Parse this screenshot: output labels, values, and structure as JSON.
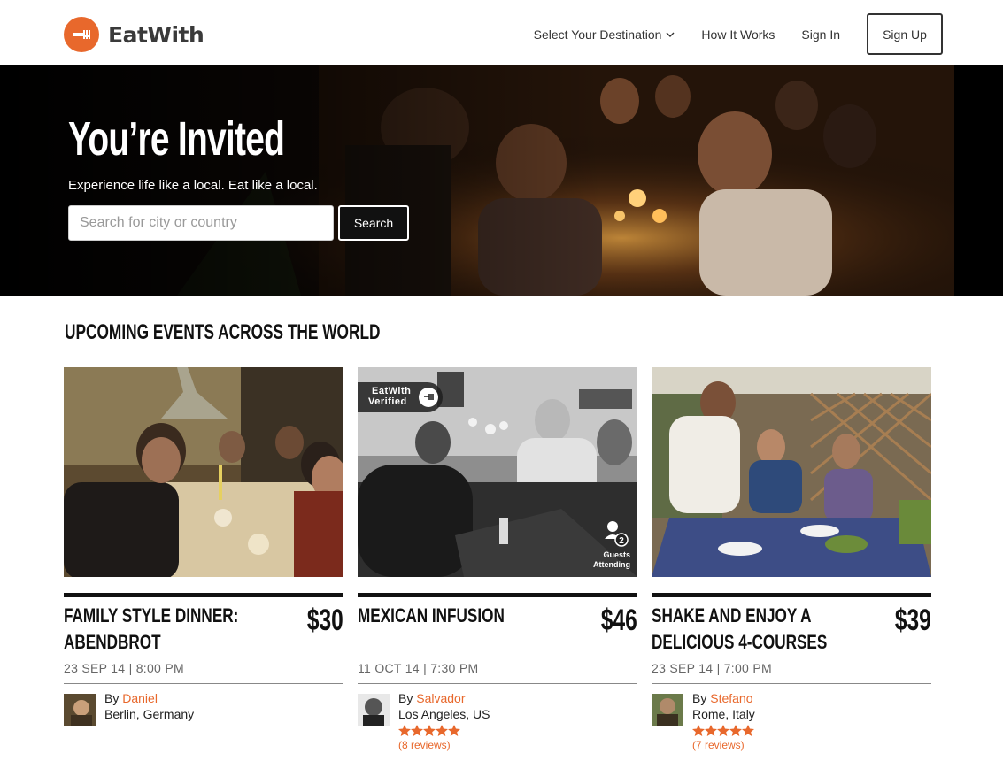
{
  "brand": {
    "name": "EatWith",
    "accent": "#e8682c"
  },
  "nav": {
    "destination": "Select Your Destination",
    "how_it_works": "How It Works",
    "sign_in": "Sign In",
    "sign_up": "Sign Up"
  },
  "hero": {
    "title": "You’re Invited",
    "subtitle": "Experience life like a local. Eat like a local.",
    "search_placeholder": "Search for city or country",
    "search_button": "Search"
  },
  "section": {
    "title": "UPCOMING EVENTS ACROSS THE WORLD"
  },
  "events": [
    {
      "title": "FAMILY STYLE DINNER: ABENDBROT",
      "price": "$30",
      "date": "23 SEP 14 | 8:00 PM",
      "by_prefix": "By",
      "host": "Daniel",
      "location": "Berlin, Germany"
    },
    {
      "title": "MEXICAN INFUSION",
      "price": "$46",
      "date": "11 OCT 14 | 7:30 PM",
      "by_prefix": "By",
      "host": "Salvador",
      "location": "Los Angeles, US",
      "rating_stars": 5,
      "reviews": "(8 reviews)",
      "badge_line1": "EatWith",
      "badge_line2": "Verified",
      "guests_count": "2",
      "guests_line1": "Guests",
      "guests_line2": "Attending"
    },
    {
      "title": "SHAKE AND ENJOY A DELICIOUS 4-COURSES",
      "price": "$39",
      "date": "23 SEP 14 | 7:00 PM",
      "by_prefix": "By",
      "host": "Stefano",
      "location": "Rome, Italy",
      "rating_stars": 5,
      "reviews": "(7 reviews)"
    }
  ]
}
